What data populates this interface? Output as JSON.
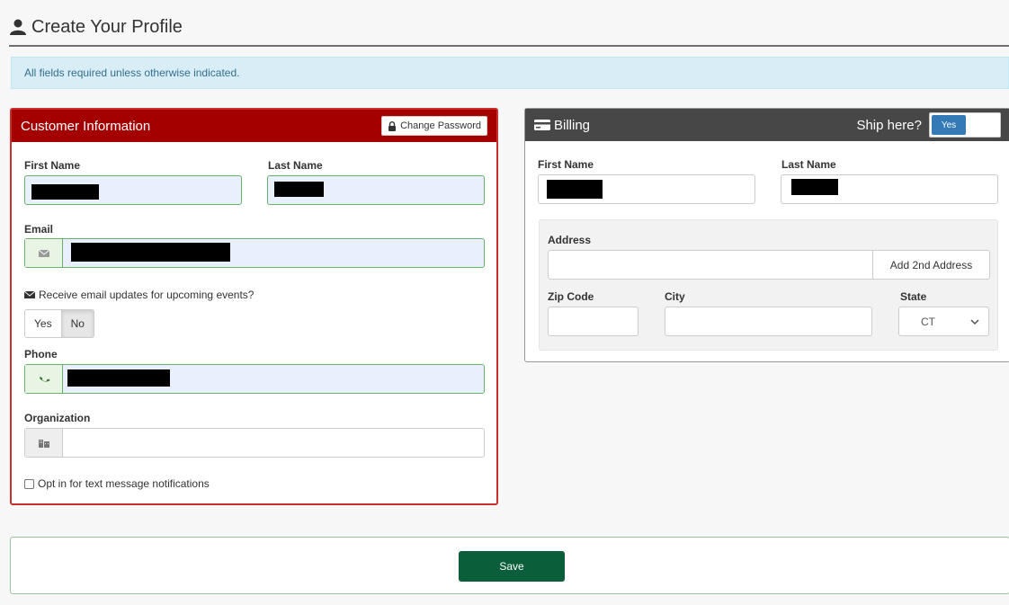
{
  "page": {
    "title": "Create Your Profile"
  },
  "alert": {
    "text": "All fields required unless otherwise indicated."
  },
  "customer": {
    "heading": "Customer Information",
    "change_password": "Change Password",
    "first_name_label": "First Name",
    "last_name_label": "Last Name",
    "email_label": "Email",
    "email_updates_label": "Receive email updates for upcoming events?",
    "yes_label": "Yes",
    "no_label": "No",
    "selected_email_updates": "No",
    "phone_label": "Phone",
    "organization_label": "Organization",
    "organization_value": "",
    "text_optin_label": "Opt in for text message notifications",
    "text_optin_checked": false
  },
  "billing": {
    "heading": "Billing",
    "ship_here_label": "Ship here?",
    "ship_here_value": "Yes",
    "first_name_label": "First Name",
    "last_name_label": "Last Name",
    "address_label": "Address",
    "address_value": "",
    "add_2nd_address": "Add 2nd Address",
    "zip_label": "Zip Code",
    "zip_value": "",
    "city_label": "City",
    "city_value": "",
    "state_label": "State",
    "state_value": "CT"
  },
  "footer": {
    "save_label": "Save"
  },
  "colors": {
    "customer_header": "#a50000",
    "billing_header": "#474747",
    "save_button": "#0b5e3a",
    "toggle_on": "#337ab7",
    "alert_bg": "#d9edf7"
  },
  "icons": {
    "page": "user-icon",
    "change_password": "lock-icon",
    "email": "envelope-icon",
    "phone": "phone-icon",
    "organization": "building-icon",
    "billing": "credit-card-icon",
    "state": "chevron-down-icon"
  }
}
